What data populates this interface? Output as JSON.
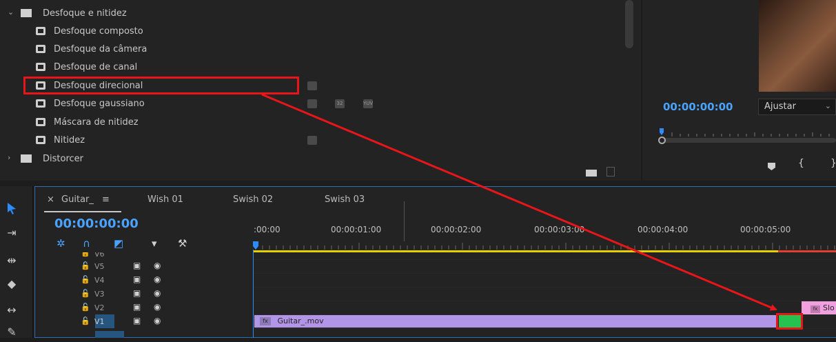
{
  "effects_panel": {
    "group_open": "Desfoque e nitidez",
    "items": [
      {
        "label": "Desfoque composto",
        "badges": []
      },
      {
        "label": "Desfoque da câmera",
        "badges": []
      },
      {
        "label": "Desfoque de canal",
        "badges": []
      },
      {
        "label": "Desfoque direcional",
        "badges": [
          "accel"
        ]
      },
      {
        "label": "Desfoque gaussiano",
        "badges": [
          "accel",
          "32",
          "YUV"
        ]
      },
      {
        "label": "Máscara de nitidez",
        "badges": []
      },
      {
        "label": "Nitidez",
        "badges": [
          "accel"
        ]
      }
    ],
    "group_closed": "Distorcer",
    "badge_32": "32",
    "badge_yuv": "YUV"
  },
  "program_monitor": {
    "timecode": "00:00:00:00",
    "fit_value": "Ajustar"
  },
  "timeline": {
    "tabs": [
      "Guitar_",
      "Wish 01",
      "Swish 02",
      "Swish 03"
    ],
    "tab_close": "×",
    "tab_menu": "≡",
    "timecode": "00:00:00:00",
    "ruler_labels": [
      ":00:00",
      "00:00:01:00",
      "00:00:02:00",
      "00:00:03:00",
      "00:00:04:00",
      "00:00:05:00"
    ],
    "tracks": [
      "V6",
      "V5",
      "V4",
      "V3",
      "V2",
      "V1"
    ],
    "clip_main": "Guitar_.mov",
    "clip_pink_prefix": "Slo",
    "fx_label": "fx"
  },
  "colors": {
    "accent": "#4aa3ff",
    "annotation": "#e8161a",
    "clip_purple": "#b395e8",
    "clip_green": "#25c24f",
    "clip_pink": "#f0a0df",
    "work_area": "#e6d000"
  }
}
